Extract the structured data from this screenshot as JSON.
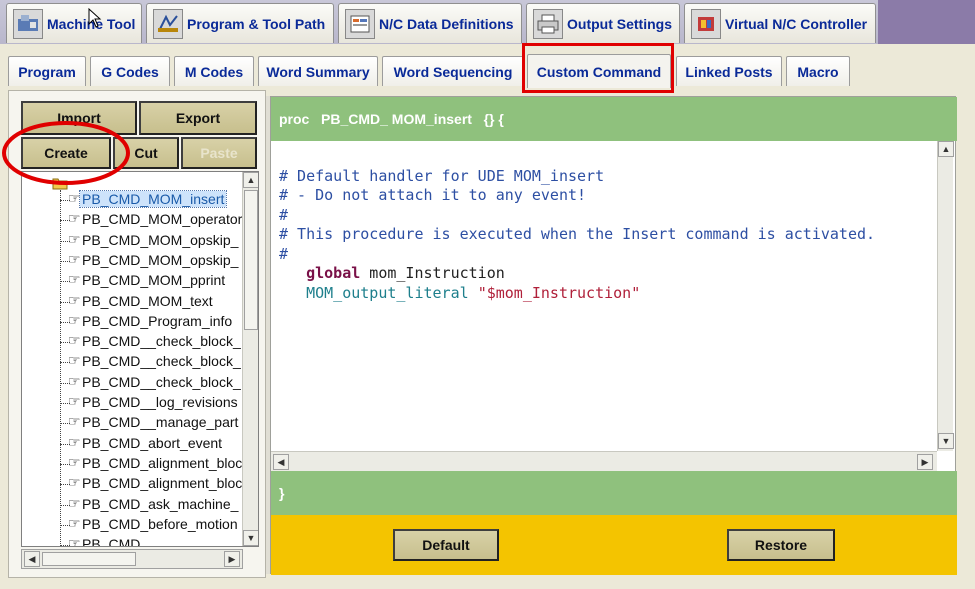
{
  "top_tabs": [
    {
      "label": "Machine Tool",
      "icon": "machine-tool-icon"
    },
    {
      "label": "Program & Tool Path",
      "icon": "program-icon"
    },
    {
      "label": "N/C Data Definitions",
      "icon": "nc-data-icon"
    },
    {
      "label": "Output Settings",
      "icon": "printer-icon"
    },
    {
      "label": "Virtual N/C Controller",
      "icon": "controller-icon"
    }
  ],
  "sub_tabs": [
    {
      "label": "Program"
    },
    {
      "label": "G Codes"
    },
    {
      "label": "M Codes"
    },
    {
      "label": "Word Summary"
    },
    {
      "label": "Word Sequencing"
    },
    {
      "label": "Custom Command"
    },
    {
      "label": "Linked Posts"
    },
    {
      "label": "Macro"
    }
  ],
  "left_buttons": {
    "import": "Import",
    "export": "Export",
    "create": "Create",
    "cut": "Cut",
    "paste": "Paste"
  },
  "tree_items": [
    "PB_CMD_MOM_insert",
    "PB_CMD_MOM_operator",
    "PB_CMD_MOM_opskip_",
    "PB_CMD_MOM_opskip_",
    "PB_CMD_MOM_pprint",
    "PB_CMD_MOM_text",
    "PB_CMD_Program_info",
    "PB_CMD__check_block_",
    "PB_CMD__check_block_",
    "PB_CMD__check_block_",
    "PB_CMD__log_revisions",
    "PB_CMD__manage_part",
    "PB_CMD_abort_event",
    "PB_CMD_alignment_bloc",
    "PB_CMD_alignment_bloc",
    "PB_CMD_ask_machine_",
    "PB_CMD_before_motion",
    "PB_CMD_..."
  ],
  "editor": {
    "header": "proc   PB_CMD_ MOM_insert   {} {",
    "lines": [
      "# Default handler for UDE MOM_insert",
      "# - Do not attach it to any event!",
      "#",
      "# This procedure is executed when the Insert command is activated.",
      "#"
    ],
    "global_kw": "global",
    "global_var": " mom_Instruction",
    "output_fn": "MOM_output_literal",
    "output_str": "\"$mom_Instruction\"",
    "footer": "}"
  },
  "bottom_buttons": {
    "default": "Default",
    "restore": "Restore"
  },
  "colors": {
    "green_bar": "#8fc17d",
    "yellow_bar": "#f4c400",
    "highlight_red": "#e00000",
    "tab_text": "#0a2a98"
  }
}
